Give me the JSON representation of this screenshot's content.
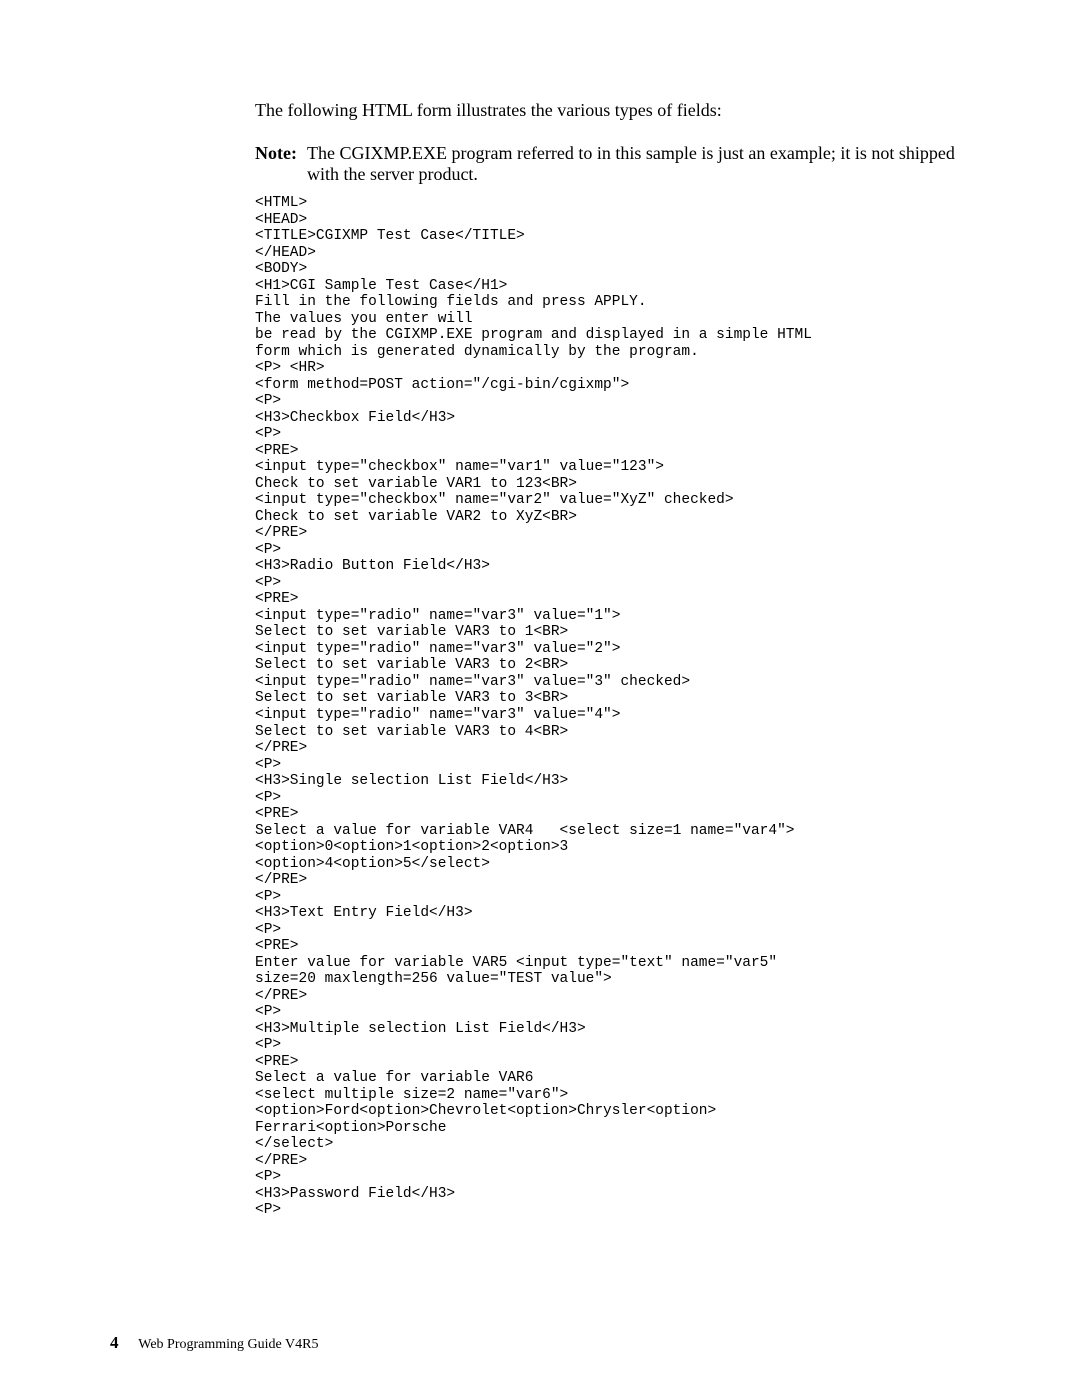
{
  "intro": "The following HTML form illustrates the various types of fields:",
  "note": {
    "label": "Note:",
    "body": "The CGIXMP.EXE program referred to in this sample is just an example; it is not shipped with the server product."
  },
  "code": "<HTML>\n<HEAD>\n<TITLE>CGIXMP Test Case</TITLE>\n</HEAD>\n<BODY>\n<H1>CGI Sample Test Case</H1>\nFill in the following fields and press APPLY.\nThe values you enter will\nbe read by the CGIXMP.EXE program and displayed in a simple HTML\nform which is generated dynamically by the program.\n<P> <HR>\n<form method=POST action=\"/cgi-bin/cgixmp\">\n<P>\n<H3>Checkbox Field</H3>\n<P>\n<PRE>\n<input type=\"checkbox\" name=\"var1\" value=\"123\">\nCheck to set variable VAR1 to 123<BR>\n<input type=\"checkbox\" name=\"var2\" value=\"XyZ\" checked>\nCheck to set variable VAR2 to XyZ<BR>\n</PRE>\n<P>\n<H3>Radio Button Field</H3>\n<P>\n<PRE>\n<input type=\"radio\" name=\"var3\" value=\"1\">\nSelect to set variable VAR3 to 1<BR>\n<input type=\"radio\" name=\"var3\" value=\"2\">\nSelect to set variable VAR3 to 2<BR>\n<input type=\"radio\" name=\"var3\" value=\"3\" checked>\nSelect to set variable VAR3 to 3<BR>\n<input type=\"radio\" name=\"var3\" value=\"4\">\nSelect to set variable VAR3 to 4<BR>\n</PRE>\n<P>\n<H3>Single selection List Field</H3>\n<P>\n<PRE>\nSelect a value for variable VAR4   <select size=1 name=\"var4\">\n<option>0<option>1<option>2<option>3\n<option>4<option>5</select>\n</PRE>\n<P>\n<H3>Text Entry Field</H3>\n<P>\n<PRE>\nEnter value for variable VAR5 <input type=\"text\" name=\"var5\"\nsize=20 maxlength=256 value=\"TEST value\">\n</PRE>\n<P>\n<H3>Multiple selection List Field</H3>\n<P>\n<PRE>\nSelect a value for variable VAR6\n<select multiple size=2 name=\"var6\">\n<option>Ford<option>Chevrolet<option>Chrysler<option>\nFerrari<option>Porsche\n</select>\n</PRE>\n<P>\n<H3>Password Field</H3>\n<P>",
  "footer": {
    "page_number": "4",
    "title": "Web Programming Guide V4R5"
  }
}
